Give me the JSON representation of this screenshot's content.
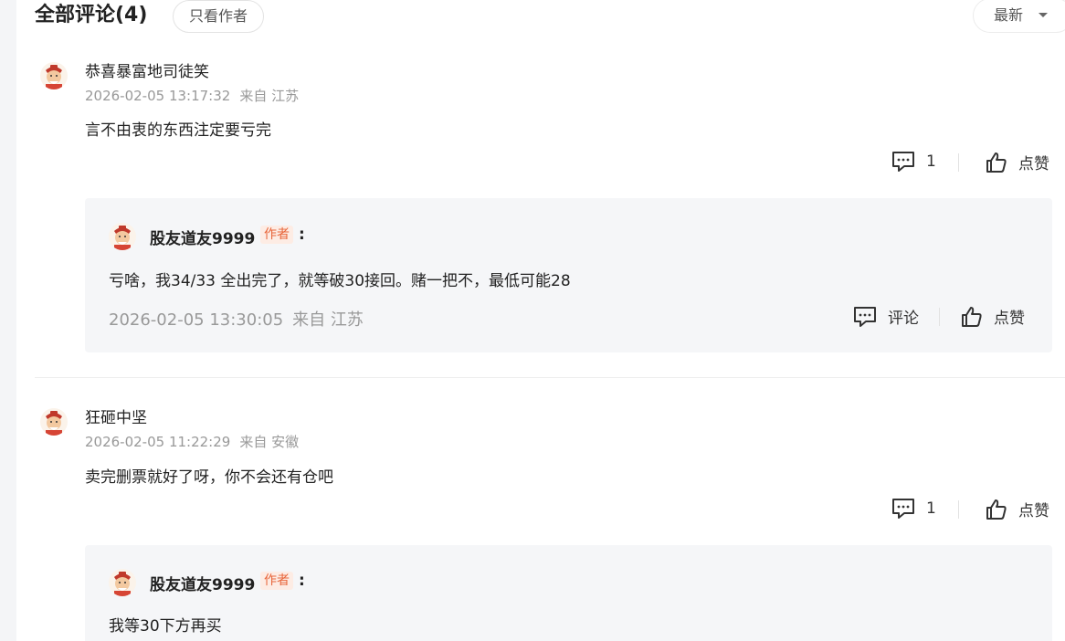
{
  "header": {
    "title": "全部评论(4)",
    "author_only": "只看作者",
    "sort": "最新"
  },
  "comments": [
    {
      "user": "恭喜暴富地司徒笑",
      "time": "2026-02-05 13:17:32",
      "location": "来自 江苏",
      "text": "言不由衷的东西注定要亏完",
      "reply_count": "1",
      "like_label": "点赞",
      "reply": {
        "user": "股友道友9999",
        "tag": "作者",
        "colon": ":",
        "text": "亏啥，我34/33 全出完了，就等破30接回。赌一把不，最低可能28",
        "time": "2026-02-05 13:30:05",
        "location": "来自 江苏",
        "comment_label": "评论",
        "like_label": "点赞"
      }
    },
    {
      "user": "狂砸中坚",
      "time": "2026-02-05 11:22:29",
      "location": "来自 安徽",
      "text": "卖完删票就好了呀，你不会还有仓吧",
      "reply_count": "1",
      "like_label": "点赞",
      "reply": {
        "user": "股友道友9999",
        "tag": "作者",
        "colon": ":",
        "text": "我等30下方再买"
      }
    }
  ],
  "icons": {
    "comment": "comment-bubble-icon",
    "like": "thumbs-up-icon",
    "avatar": "fortune-god-avatar"
  },
  "colors": {
    "author_tag": "#e8653a",
    "author_tag_bg": "#fdece4",
    "reply_bg": "#f5f6f8",
    "meta_text": "#999999"
  }
}
